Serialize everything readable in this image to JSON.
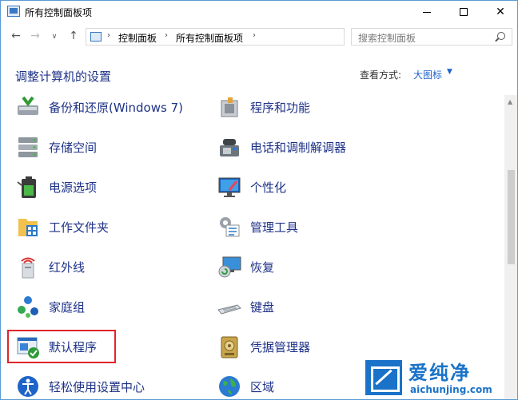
{
  "window": {
    "title": "所有控制面板项",
    "controls": {
      "minimize": "",
      "maximize": "",
      "close": "✕"
    }
  },
  "nav": {
    "back": "←",
    "forward": "→",
    "recent": "∨",
    "up": "↑",
    "address": {
      "separator": "›",
      "crumbs": [
        "控制面板",
        "所有控制面板项"
      ],
      "dropdown": "∨",
      "refresh": "↻"
    },
    "search": {
      "placeholder": "搜索控制面板"
    }
  },
  "header": {
    "title": "调整计算机的设置",
    "view_by_label": "查看方式:",
    "view_by_value": "大图标",
    "view_by_caret": "▼"
  },
  "items": {
    "left": [
      {
        "label": "备份和还原(Windows 7)",
        "icon": "backup-restore-icon"
      },
      {
        "label": "存储空间",
        "icon": "storage-spaces-icon"
      },
      {
        "label": "电源选项",
        "icon": "power-options-icon"
      },
      {
        "label": "工作文件夹",
        "icon": "work-folders-icon"
      },
      {
        "label": "红外线",
        "icon": "infrared-icon"
      },
      {
        "label": "家庭组",
        "icon": "homegroup-icon"
      },
      {
        "label": "默认程序",
        "icon": "default-programs-icon"
      },
      {
        "label": "轻松使用设置中心",
        "icon": "ease-of-access-icon"
      }
    ],
    "right": [
      {
        "label": "程序和功能",
        "icon": "programs-features-icon"
      },
      {
        "label": "电话和调制解调器",
        "icon": "phone-modem-icon"
      },
      {
        "label": "个性化",
        "icon": "personalization-icon"
      },
      {
        "label": "管理工具",
        "icon": "admin-tools-icon"
      },
      {
        "label": "恢复",
        "icon": "recovery-icon"
      },
      {
        "label": "键盘",
        "icon": "keyboard-icon"
      },
      {
        "label": "凭据管理器",
        "icon": "credential-manager-icon"
      },
      {
        "label": "区域",
        "icon": "region-icon"
      }
    ]
  },
  "scrollbar": {
    "up": "▲"
  },
  "watermark": {
    "text": "爱纯净",
    "url": "aichunjing.com"
  },
  "colors": {
    "link": "#1e3287",
    "accent": "#1e64c8",
    "highlight": "#e0252b"
  }
}
